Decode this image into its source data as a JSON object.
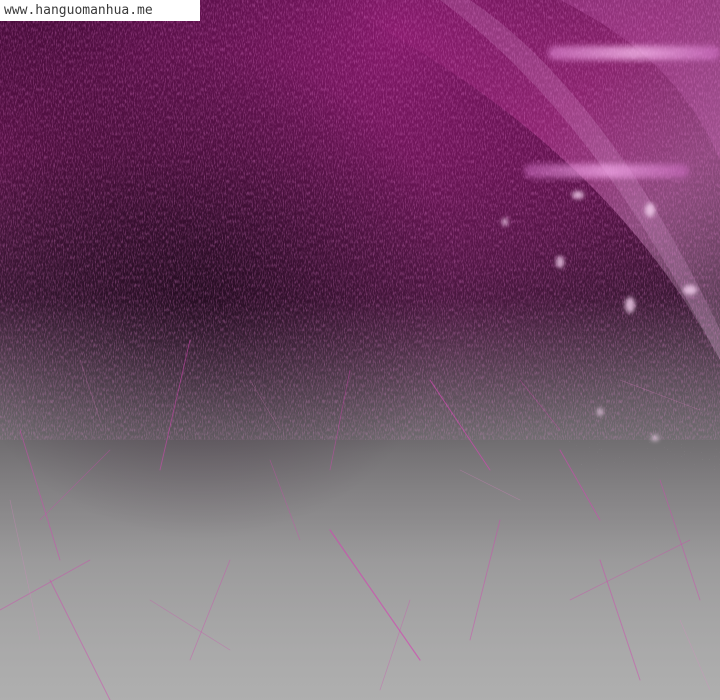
{
  "watermark": {
    "text": "www.hanguomanhua.me"
  },
  "colors": {
    "dark_magenta": "#3a0a2e",
    "magenta": "#a0206e",
    "bright_magenta": "#e060c0",
    "fog_gray": "#9c9c9c",
    "watermark_bg": "#ffffff"
  },
  "icons": {
    "panel": "abstract-scratched-magenta-texture"
  }
}
